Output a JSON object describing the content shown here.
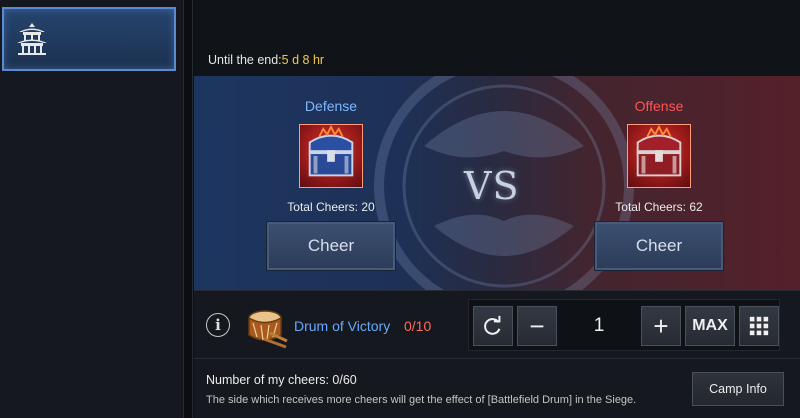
{
  "sidebar": {
    "tabs": [
      {
        "icon": "pagoda-icon",
        "selected": true
      }
    ]
  },
  "header": {
    "timer_label": "Until the end:",
    "timer_value": "5 d 8 hr"
  },
  "versus": {
    "vs_text": "VS",
    "defense": {
      "title": "Defense",
      "total_label": "Total Cheers: 20",
      "cheer_label": "Cheer",
      "color": "#7fb8ff",
      "chest_icon": "blue-treasure-chest-icon"
    },
    "offense": {
      "title": "Offense",
      "total_label": "Total Cheers: 62",
      "cheer_label": "Cheer",
      "color": "#ff5555",
      "chest_icon": "red-treasure-chest-icon"
    }
  },
  "drum": {
    "info_symbol": "i",
    "name": "Drum of Victory",
    "count": "0/10",
    "name_color": "#67a9ff",
    "count_color": "#ff6b5a",
    "icon": "war-drum-icon"
  },
  "stepper": {
    "quantity": "1",
    "minus_symbol": "−",
    "plus_symbol": "+",
    "max_label": "MAX",
    "reset_icon": "reset-icon",
    "keypad_icon": "keypad-icon"
  },
  "footer": {
    "my_cheers": "Number of my cheers: 0/60",
    "description": "The side which receives more cheers will get the effect of [Battlefield Drum] in the Siege.",
    "camp_info_label": "Camp Info"
  }
}
